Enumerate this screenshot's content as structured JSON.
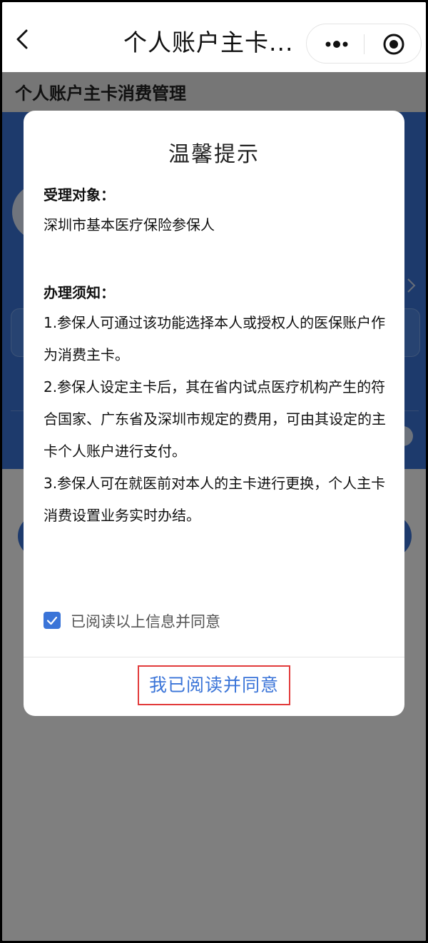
{
  "navbar": {
    "title": "个人账户主卡...",
    "back_icon": "chevron-left-icon",
    "more_icon": "more-dots-icon",
    "close_icon": "target-circle-icon"
  },
  "page": {
    "section_title": "个人账户主卡消费管理"
  },
  "modal": {
    "title": "温馨提示",
    "target_heading": "受理对象：",
    "target_text": "深圳市基本医疗保险参保人",
    "notice_heading": "办理须知：",
    "notice_items": [
      "1.参保人可通过该功能选择本人或授权人的医保账户作为消费主卡。",
      "2.参保人设定主卡后，其在省内试点医疗机构产生的符合国家、广东省及深圳市规定的费用，可由其设定的主卡个人账户进行支付。",
      "3.参保人可在就医前对本人的主卡进行更换，个人主卡消费设置业务实时办结。"
    ],
    "agree_label": "已阅读以上信息并同意",
    "agree_checked": true,
    "confirm_label": "我已阅读并同意"
  },
  "colors": {
    "accent": "#3a74d8",
    "highlight_border": "#e23b3b"
  }
}
